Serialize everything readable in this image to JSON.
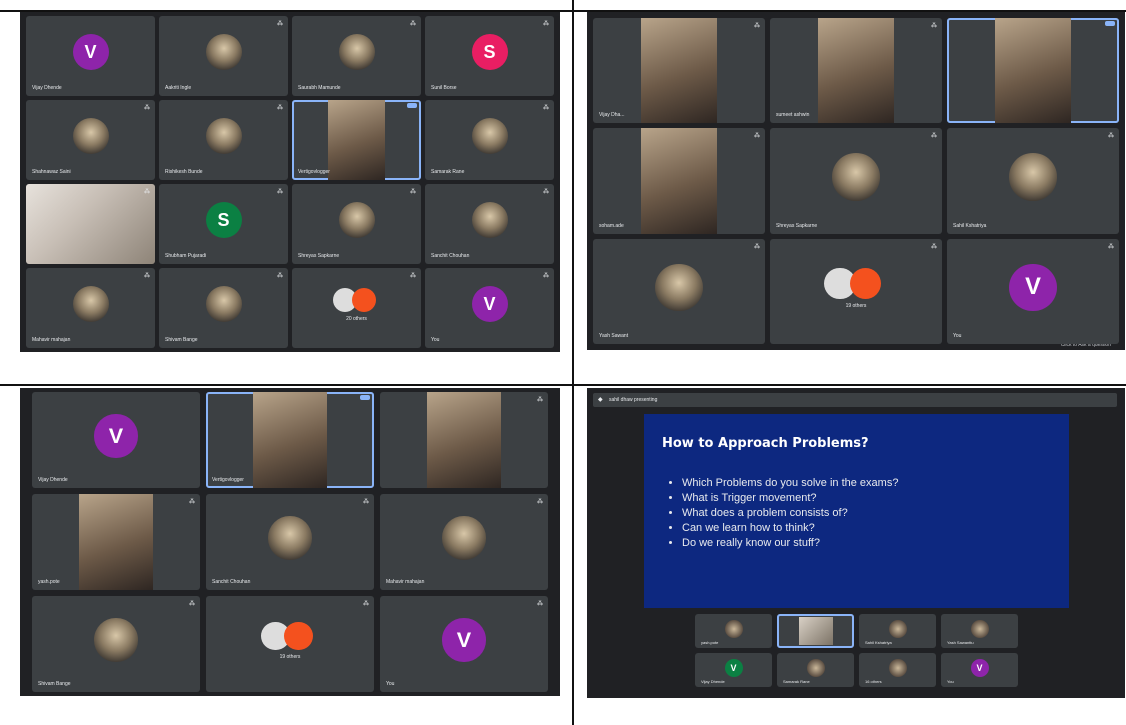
{
  "q1": {
    "tiles": [
      {
        "name": "Vijay Dhende",
        "avatar": "V",
        "color": "purple"
      },
      {
        "name": "Aakriti Ingle",
        "photo": true
      },
      {
        "name": "Saurabh Mamunde",
        "photo": true
      },
      {
        "name": "Sunil Borse",
        "avatar": "S",
        "color": "pink"
      },
      {
        "name": "Shahnawaz Saini",
        "photo": true
      },
      {
        "name": "Rishikesh Bunde",
        "photo": true
      },
      {
        "name": "Vertigovlogger",
        "video": true,
        "active": true
      },
      {
        "name": "Samarak Rane",
        "photo": true
      },
      {
        "name": "",
        "video": true,
        "presenter": true
      },
      {
        "name": "Shubham Pujaradi",
        "avatar": "S",
        "color": "green"
      },
      {
        "name": "Shreyas Sapkarne",
        "photo": true
      },
      {
        "name": "Sanchit Chouhan",
        "photo": true
      },
      {
        "name": "Mahavir mahajan",
        "photo": true
      },
      {
        "name": "Shivam Bange",
        "photo": true
      },
      {
        "name": "",
        "others": "20 others",
        "group": true
      },
      {
        "name": "You",
        "avatar": "V",
        "color": "purple"
      }
    ]
  },
  "q2": {
    "tiles": [
      {
        "name": "Vijay Dha...",
        "video": true
      },
      {
        "name": "sumeet ashwin",
        "video": true
      },
      {
        "name": "",
        "video": true,
        "active": true
      },
      {
        "name": "soham.ade",
        "video": true
      },
      {
        "name": "Shreyas Sapkarne",
        "photo": true
      },
      {
        "name": "Sahil Kshatriya",
        "photo": true
      },
      {
        "name": "Yash Sawant",
        "photo": true
      },
      {
        "name": "",
        "others": "19 others",
        "group": true
      },
      {
        "name": "You",
        "avatar": "V",
        "color": "purple"
      }
    ],
    "footer": "Click to Ask a question"
  },
  "q3": {
    "tiles": [
      {
        "name": "Vijay Dhende",
        "avatar": "V",
        "color": "purple"
      },
      {
        "name": "Vertigovlogger",
        "video": true,
        "active": true
      },
      {
        "name": "",
        "video": true
      },
      {
        "name": "yash.pote",
        "video": true
      },
      {
        "name": "Sanchit Chouhan",
        "photo": true
      },
      {
        "name": "Mahavir mahajan",
        "photo": true
      },
      {
        "name": "Shivam Bange",
        "photo": true
      },
      {
        "name": "",
        "others": "19 others",
        "group": true
      },
      {
        "name": "You",
        "avatar": "V",
        "color": "purple"
      }
    ]
  },
  "q4": {
    "presenter_label": "sahil dhaw presenting",
    "slide": {
      "title": "How to Approach Problems?",
      "bullets": [
        "Which Problems do you solve in the exams?",
        "What is  Trigger movement?",
        "What does a problem consists of?",
        "Can we learn how to think?",
        "Do we really know our stuff?"
      ]
    },
    "strip": [
      {
        "name": "yash.pote"
      },
      {
        "name": "",
        "active": true
      },
      {
        "name": "Sahil Kshatriya"
      },
      {
        "name": "Yash Sawanttu"
      },
      {
        "name": "Vijay Dhende",
        "avatar": "V",
        "color": "green"
      },
      {
        "name": "Samarak Rane"
      },
      {
        "name": "16 others"
      },
      {
        "name": "You",
        "avatar": "V",
        "color": "purple"
      }
    ]
  }
}
